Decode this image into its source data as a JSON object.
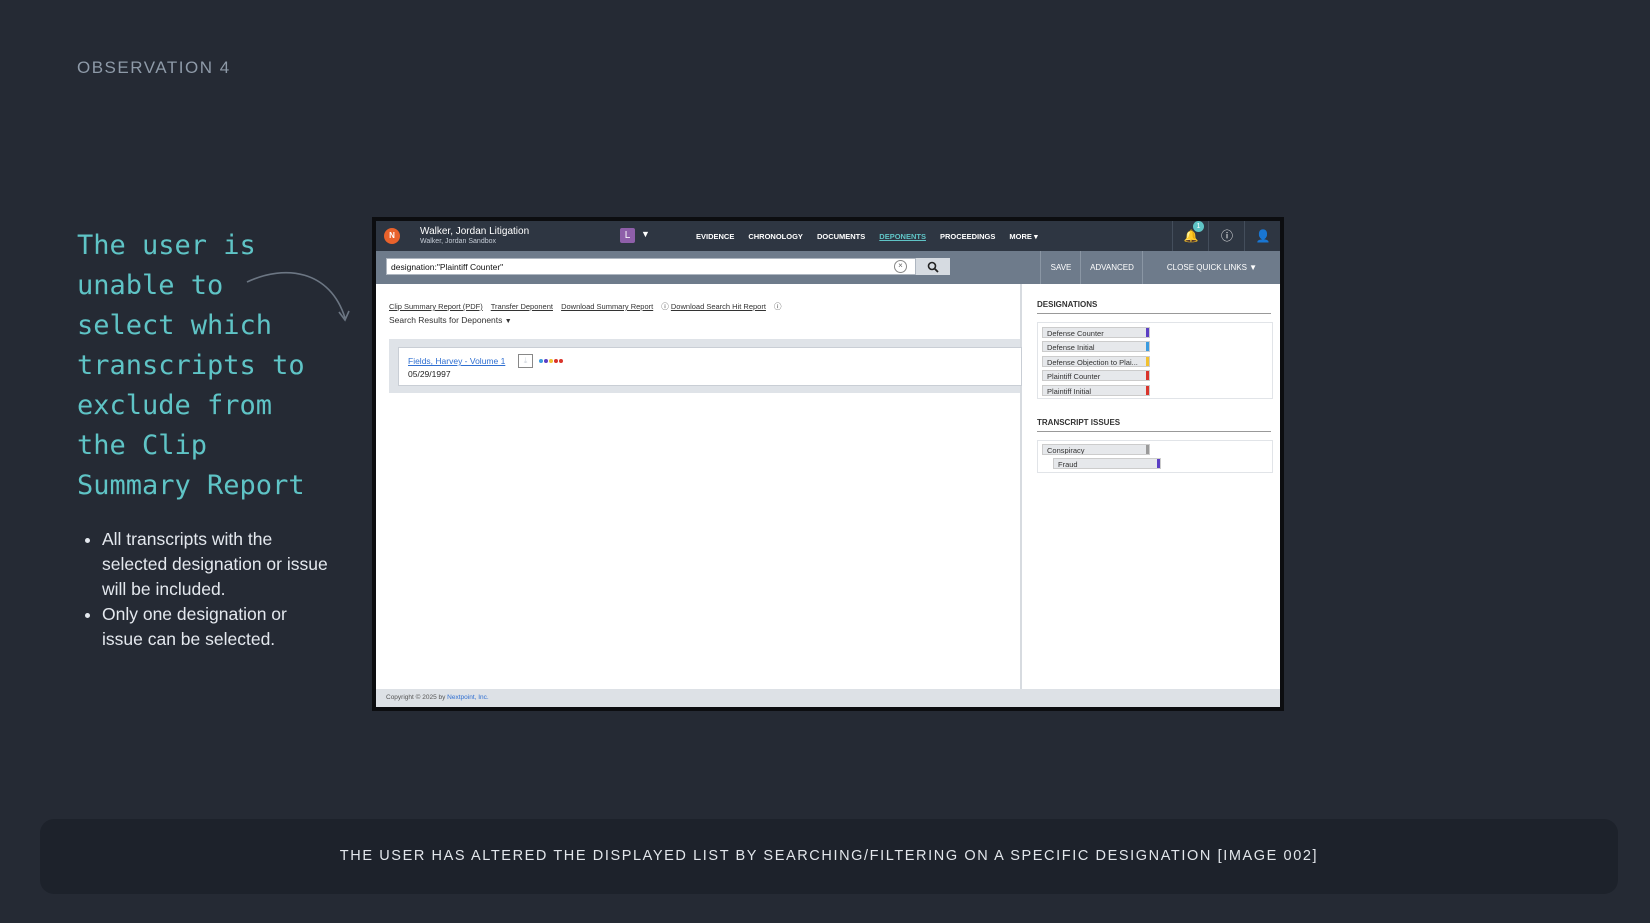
{
  "slide": {
    "observation_label": "OBSERVATION 4",
    "headline": "The user is unable to select which transcripts to exclude from the Clip Summary Report",
    "bullets": [
      "All transcripts with the selected designation or issue will be included.",
      "Only one designation or issue can be selected."
    ],
    "caption": "THE USER HAS ALTERED THE DISPLAYED LIST BY SEARCHING/FILTERING ON A SPECIFIC DESIGNATION [IMAGE 002]"
  },
  "app": {
    "case_title": "Walker, Jordan Litigation",
    "case_subtitle": "Walker, Jordan Sandbox",
    "user_initial": "L",
    "nav": [
      "EVIDENCE",
      "CHRONOLOGY",
      "DOCUMENTS",
      "DEPONENTS",
      "PROCEEDINGS",
      "MORE ▾"
    ],
    "notification_count": "1",
    "search_value": "designation:\"Plaintiff Counter\"",
    "buttons": {
      "save": "SAVE",
      "advanced": "ADVANCED",
      "close_quick_links": "CLOSE QUICK LINKS"
    },
    "links": [
      "Clip Summary Report (PDF)",
      "Transfer Deponent",
      "Download Summary Report",
      "Download Search Hit Report"
    ],
    "results_header": "Search Results for Deponents",
    "result": {
      "title": "Fields, Harvey - Volume 1",
      "date": "05/29/1997"
    },
    "designations": {
      "heading": "DESIGNATIONS",
      "items": [
        {
          "label": "Defense Counter",
          "color": "#5b3fc4"
        },
        {
          "label": "Defense Initial",
          "color": "#3b9be0"
        },
        {
          "label": "Defense Objection to Plai...",
          "color": "#f2c12e"
        },
        {
          "label": "Plaintiff Counter",
          "color": "#d9342b"
        },
        {
          "label": "Plaintiff Initial",
          "color": "#d9342b"
        }
      ]
    },
    "issues": {
      "heading": "TRANSCRIPT ISSUES",
      "items": [
        {
          "label": "Conspiracy",
          "color": "#9a9a9a"
        },
        {
          "label": "Fraud",
          "color": "#5b3fc4"
        }
      ]
    },
    "footer": {
      "prefix": "Copyright © 2025 by ",
      "company": "Nextpoint, Inc."
    },
    "accent": "#5fc4c6"
  }
}
